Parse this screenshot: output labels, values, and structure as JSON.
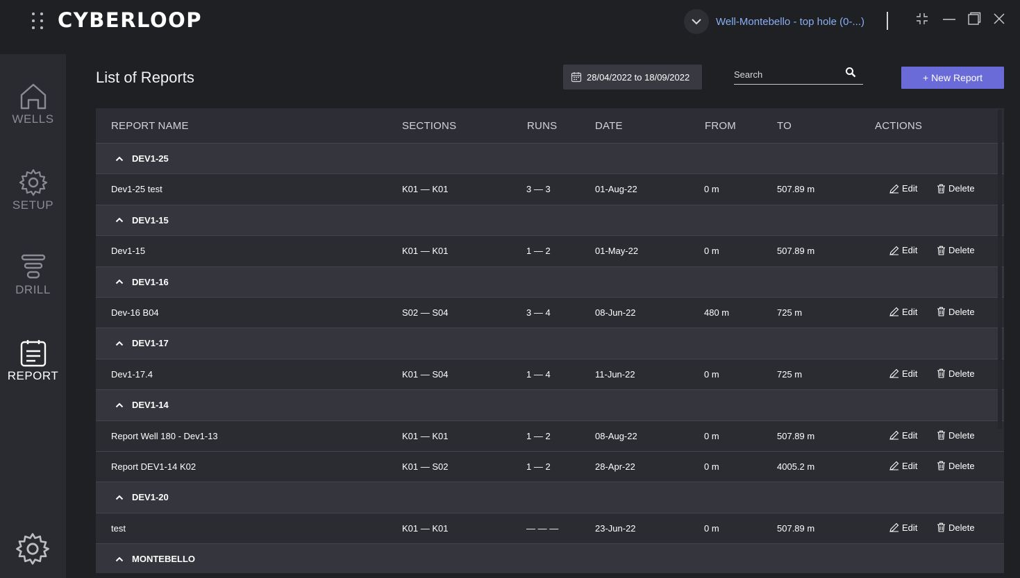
{
  "app": {
    "logo": "CYBERLOOP",
    "well_selector": "Well-Montebello - top hole (0-...)"
  },
  "sidebar": {
    "items": [
      {
        "label": "WELLS",
        "icon": "home-icon",
        "active": false
      },
      {
        "label": "SETUP",
        "icon": "gear-icon",
        "active": false
      },
      {
        "label": "DRILL",
        "icon": "drill-icon",
        "active": false
      },
      {
        "label": "REPORT",
        "icon": "report-icon",
        "active": true
      }
    ]
  },
  "main": {
    "title": "List of Reports",
    "date_range": "28/04/2022 to 18/09/2022",
    "search_placeholder": "Search",
    "new_report_label": "+ New Report"
  },
  "table": {
    "headers": {
      "name": "REPORT NAME",
      "sections": "SECTIONS",
      "runs": "RUNS",
      "date": "DATE",
      "from": "FROM",
      "to": "TO",
      "actions": "ACTIONS"
    },
    "edit_label": "Edit",
    "delete_label": "Delete",
    "groups": [
      {
        "name": "DEV1-25",
        "rows": [
          {
            "name": "Dev1-25 test",
            "sections": "K01 — K01",
            "runs": "3 — 3",
            "date": "01-Aug-22",
            "from": "0 m",
            "to": "507.89 m"
          }
        ]
      },
      {
        "name": "DEV1-15",
        "rows": [
          {
            "name": "Dev1-15",
            "sections": "K01 — K01",
            "runs": "1 — 2",
            "date": "01-May-22",
            "from": "0 m",
            "to": "507.89 m"
          }
        ]
      },
      {
        "name": "DEV1-16",
        "rows": [
          {
            "name": "Dev-16 B04",
            "sections": "S02 — S04",
            "runs": "3 — 4",
            "date": "08-Jun-22",
            "from": "480 m",
            "to": "725 m"
          }
        ]
      },
      {
        "name": "DEV1-17",
        "rows": [
          {
            "name": "Dev1-17.4",
            "sections": "K01 — S04",
            "runs": "1 — 4",
            "date": "11-Jun-22",
            "from": "0 m",
            "to": "725 m"
          }
        ]
      },
      {
        "name": "DEV1-14",
        "rows": [
          {
            "name": "Report Well 180 - Dev1-13",
            "sections": "K01 — K01",
            "runs": "1 — 2",
            "date": "08-Aug-22",
            "from": "0 m",
            "to": "507.89 m"
          },
          {
            "name": "Report DEV1-14 K02",
            "sections": "K01 — S02",
            "runs": "1 — 2",
            "date": "28-Apr-22",
            "from": "0 m",
            "to": "4005.2 m"
          }
        ]
      },
      {
        "name": "DEV1-20",
        "rows": [
          {
            "name": "test",
            "sections": "K01 — K01",
            "runs": "— — —",
            "date": "23-Jun-22",
            "from": "0 m",
            "to": "507.89 m"
          }
        ]
      },
      {
        "name": "MONTEBELLO",
        "rows": []
      }
    ]
  },
  "colors": {
    "accent": "#6a6ad8",
    "link": "#8aaef2",
    "background": "#1f2024",
    "sidebar": "#2a2b30"
  }
}
